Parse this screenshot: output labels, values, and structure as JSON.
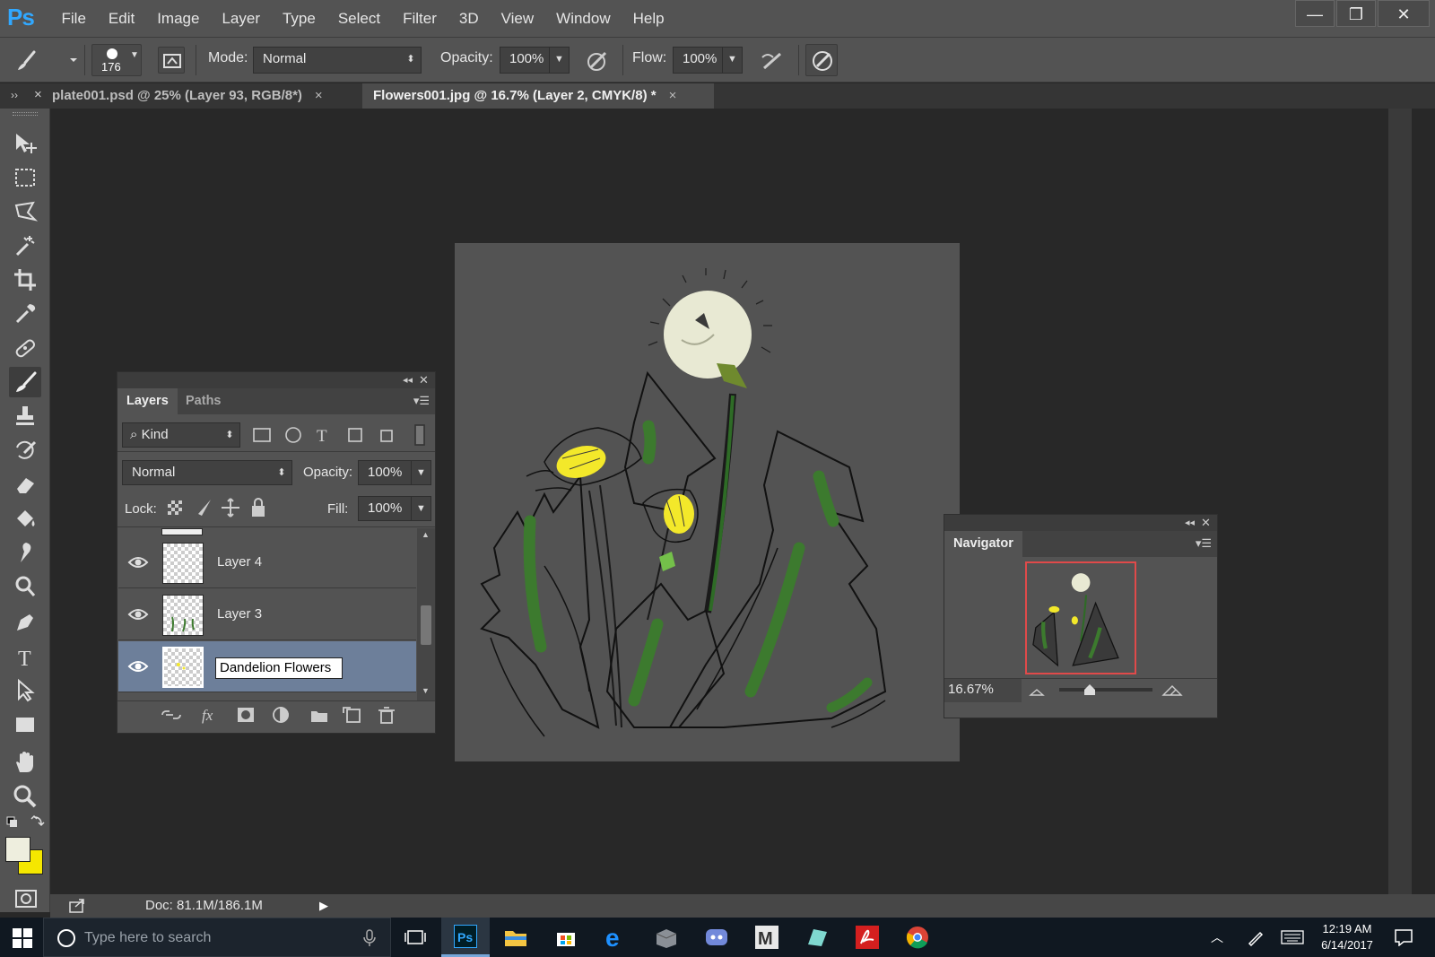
{
  "app": {
    "logo": "Ps",
    "menus": [
      "File",
      "Edit",
      "Image",
      "Layer",
      "Type",
      "Select",
      "Filter",
      "3D",
      "View",
      "Window",
      "Help"
    ],
    "window_controls": {
      "minimize": "—",
      "restore": "❐",
      "close": "✕"
    }
  },
  "options": {
    "brush_size": "176",
    "mode_label": "Mode:",
    "mode_value": "Normal",
    "opacity_label": "Opacity:",
    "opacity_value": "100%",
    "flow_label": "Flow:",
    "flow_value": "100%"
  },
  "tabs": [
    {
      "label": "plate001.psd @ 25% (Layer 93, RGB/8*)",
      "close": "×"
    },
    {
      "label": "Flowers001.jpg @ 16.7% (Layer 2, CMYK/8) *",
      "close": "×"
    }
  ],
  "tab_panel_controls": {
    "expand": "››",
    "close": "×"
  },
  "layers_panel": {
    "tabs": [
      "Layers",
      "Paths"
    ],
    "filter_label": "Kind",
    "blend_mode": "Normal",
    "opacity_label": "Opacity:",
    "opacity_value": "100%",
    "lock_label": "Lock:",
    "fill_label": "Fill:",
    "fill_value": "100%",
    "layers": [
      {
        "name": "Layer 4",
        "visible": true,
        "selected": false
      },
      {
        "name": "Layer 3",
        "visible": true,
        "selected": false
      },
      {
        "name": "Dandelion Flowers",
        "visible": true,
        "selected": true,
        "editing": true
      }
    ],
    "bottom_icons": [
      "link-icon",
      "fx-icon",
      "mask-icon",
      "adjustment-icon",
      "folder-icon",
      "new-layer-icon",
      "trash-icon"
    ],
    "fx_label": "fx"
  },
  "navigator_panel": {
    "title": "Navigator",
    "zoom_value": "16.67%"
  },
  "status": {
    "doc_info": "Doc: 81.1M/186.1M"
  },
  "taskbar": {
    "search_placeholder": "Type here to search",
    "time": "12:19 AM",
    "date": "6/14/2017"
  },
  "colors": {
    "foreground": "#eeeede",
    "background": "#f5e700",
    "ps_blue": "#31a8ff",
    "selected_layer": "#6d7f9a"
  }
}
